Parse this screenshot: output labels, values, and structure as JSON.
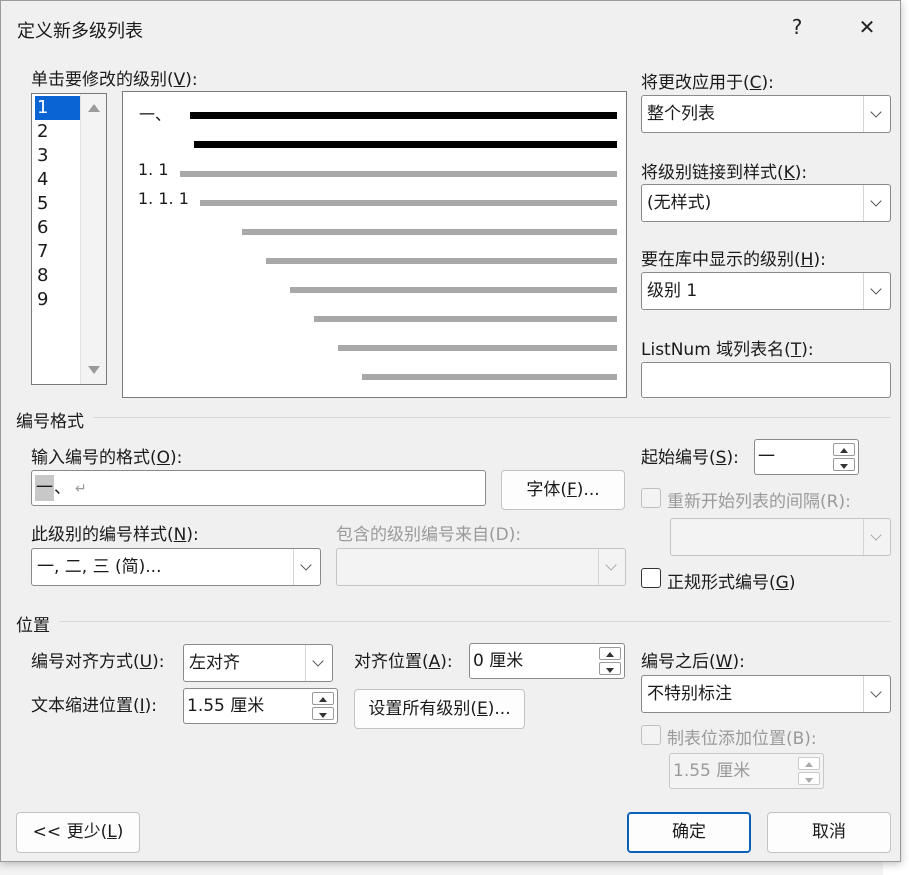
{
  "dialog": {
    "title": "定义新多级列表",
    "help": "?",
    "close": "✕"
  },
  "level_select": {
    "label": "单击要修改的级别(",
    "label_key": "V",
    "label_end": "):",
    "levels": [
      "1",
      "2",
      "3",
      "4",
      "5",
      "6",
      "7",
      "8",
      "9"
    ],
    "selected": "1"
  },
  "preview": {
    "line1": "一、",
    "line3": "1. 1",
    "line4": "1. 1. 1"
  },
  "apply_to": {
    "label": "将更改应用于(",
    "key": "C",
    "end": "):",
    "value": "整个列表"
  },
  "link_style": {
    "label": "将级别链接到样式(",
    "key": "K",
    "end": "):",
    "value": "(无样式)"
  },
  "gallery_level": {
    "label": "要在库中显示的级别(",
    "key": "H",
    "end": "):",
    "value": "级别 1"
  },
  "listnum": {
    "label": "ListNum 域列表名(",
    "key": "T",
    "end": "):",
    "value": ""
  },
  "number_format_section": "编号格式",
  "format_input": {
    "label": "输入编号的格式(",
    "key": "O",
    "end": "):",
    "selected_part": "一",
    "rest": "、",
    "paragraph_mark": "↵"
  },
  "font_button": {
    "label": "字体(",
    "key": "F",
    "end": ")..."
  },
  "start_at": {
    "label": "起始编号(",
    "key": "S",
    "end": "):",
    "value": "一"
  },
  "restart_list": {
    "label": "重新开始列表的间隔(R):",
    "value": ""
  },
  "number_style": {
    "label": "此级别的编号样式(",
    "key": "N",
    "end": "):",
    "value": "一, 二, 三 (简)..."
  },
  "include_level": {
    "label": "包含的级别编号来自(D):",
    "value": ""
  },
  "legal_style": {
    "label": "正规形式编号(",
    "key": "G",
    "end": ")"
  },
  "position_section": "位置",
  "alignment": {
    "label": "编号对齐方式(",
    "key": "U",
    "end": "):",
    "value": "左对齐"
  },
  "aligned_at": {
    "label": "对齐位置(",
    "key": "A",
    "end": "):",
    "value": "0 厘米"
  },
  "indent_at": {
    "label": "文本缩进位置(",
    "key": "I",
    "end": "):",
    "value": "1.55 厘米"
  },
  "set_all_levels": {
    "label": "设置所有级别(",
    "key": "E",
    "end": ")..."
  },
  "follow_number": {
    "label": "编号之后(",
    "key": "W",
    "end": "):",
    "value": "不特别标注"
  },
  "add_tab_stop": {
    "label": "制表位添加位置(B):",
    "value": "1.55 厘米"
  },
  "less_button": {
    "label": "<< 更少(",
    "key": "L",
    "end": ")"
  },
  "ok_button": "确定",
  "cancel_button": "取消"
}
